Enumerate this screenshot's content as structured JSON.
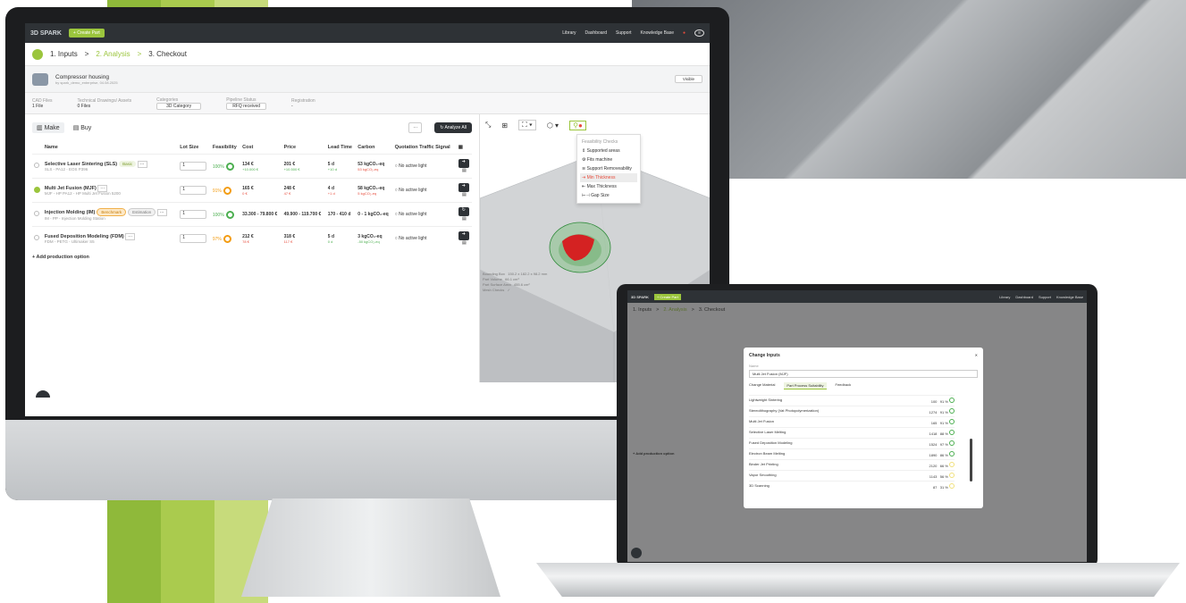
{
  "brand": {
    "stripe_colors": [
      "#9bc53d",
      "#b6d155",
      "#cbdb7e"
    ],
    "accent": "#9bc53d",
    "dark": "#2e3236"
  },
  "app": {
    "logo_text": "3D SPARK",
    "create_button": "+ Create Part",
    "nav": [
      "Library",
      "Dashboard",
      "Support",
      "Knowledge Base"
    ]
  },
  "breadcrumb": {
    "steps": [
      "1. Inputs",
      ">",
      "2. Analysis",
      ">",
      "3. Checkout"
    ]
  },
  "project": {
    "title": "Compressor housing",
    "subtitle": "by spark_demo_enterprise, 04.08.2025",
    "right_value": "Visible"
  },
  "meta": {
    "cad_label": "CAD Files",
    "cad_value": "1 File",
    "tech_label": "Technical Drawings/ Assets",
    "tech_value": "0 Files",
    "cat_label": "Categories",
    "cat_value": "3D Category",
    "pipeline_label": "Pipeline Status",
    "pipeline_value": "RFQ received",
    "reg_label": "Registration",
    "reg_value": "-"
  },
  "tabs": {
    "make": "Make",
    "buy": "Buy",
    "analyze_all": "Analyze All",
    "more": "···"
  },
  "table": {
    "headers": [
      "Name",
      "Lot Size",
      "Feasibility",
      "Cost",
      "Price",
      "Lead Time",
      "Carbon",
      "Quotation Traffic Signal"
    ],
    "rows": [
      {
        "name": "Selective Laser Sintering (SLS)",
        "sub": "SLS - PA12 - EOS P396",
        "badge": "Basic",
        "lot": "1",
        "feas": "100%",
        "cost": "134 €",
        "cost_sub": "+10.000 €",
        "price": "201 €",
        "price_sub": "+10.500 €",
        "lead": "5 d",
        "lead_sub": "+10 d",
        "carbon": "53 kgCO₂-eq",
        "carbon_sub": "53 kgCO₂-eq",
        "signal": "No active light"
      },
      {
        "name": "Multi Jet Fusion (MJF)",
        "sub": "MJF - HP PA12 - HP Multi Jet Fusion 5200",
        "badge": "",
        "lot": "1",
        "feas": "91%",
        "cost": "165 €",
        "cost_sub": "0 €",
        "price": "248 €",
        "price_sub": "47 €",
        "lead": "4 d",
        "lead_sub": "+1 d",
        "carbon": "58 kgCO₂-eq",
        "carbon_sub": "5 kgCO₂-eq",
        "signal": "No active light"
      },
      {
        "name": "Injection Molding (IM)",
        "sub": "IM - PP - Injection Molding Station",
        "badge": "Benchmark",
        "badge2": "Estimation",
        "lot": "1",
        "feas": "100%",
        "cost": "33.300 - 79.800 €",
        "cost_sub": "",
        "price": "49.900 - 119.700 €",
        "price_sub": "",
        "lead": "170 - 410 d",
        "lead_sub": "",
        "carbon": "0 - 1 kgCO₂-eq",
        "carbon_sub": "",
        "signal": "No active light"
      },
      {
        "name": "Fused Deposition Modeling (FDM)",
        "sub": "FDM - PETG - Ultimaker S5",
        "badge": "",
        "lot": "1",
        "feas": "97%",
        "cost": "212 €",
        "cost_sub": "78 €",
        "price": "318 €",
        "price_sub": "117 €",
        "lead": "5 d",
        "lead_sub": "0 d",
        "carbon": "3 kgCO₂-eq",
        "carbon_sub": "-50 kgCO₂-eq",
        "signal": "No active light"
      }
    ],
    "add_option": "+ Add production option"
  },
  "viewer": {
    "dropdown_title": "Feasibility Checks",
    "checks": [
      "Supported areas",
      "Fits machine",
      "Support Removeability",
      "Min Thickness",
      "Max Thickness",
      "Gap Size"
    ],
    "selected_check": "Min Thickness",
    "info": [
      {
        "label": "Bounding Box",
        "value": "150.2 x 182.2 x 98.2 mm"
      },
      {
        "label": "Part Volume",
        "value": "66.1 cm³"
      },
      {
        "label": "Part Surface Area",
        "value": "455.6 cm²"
      },
      {
        "label": "Mesh Checks",
        "value": "✓"
      }
    ]
  },
  "modal": {
    "title": "Change Inputs",
    "field_label": "Name",
    "field_value": "Multi Jet Fusion (MJF)",
    "tabs": [
      "Change Material",
      "Part Process Suitability",
      "Feedback"
    ],
    "active_tab": "Part Process Suitability",
    "rows": [
      {
        "name": "Lightweight Sintering",
        "v1": "100",
        "v2": "91 %",
        "ring": "g"
      },
      {
        "name": "Stereolithography (Vat Photopolymerization)",
        "v1": "1274",
        "v2": "91 %",
        "ring": "g"
      },
      {
        "name": "Multi Jet Fusion",
        "v1": "165",
        "v2": "91 %",
        "ring": "g"
      },
      {
        "name": "Selective Laser Melting",
        "v1": "1418",
        "v2": "88 %",
        "ring": "g"
      },
      {
        "name": "Fused Deposition Modeling",
        "v1": "1524",
        "v2": "97 %",
        "ring": "g"
      },
      {
        "name": "Electron Beam Melting",
        "v1": "1890",
        "v2": "86 %",
        "ring": "g"
      },
      {
        "name": "Binder Jet Printing",
        "v1": "2120",
        "v2": "66 %",
        "ring": "y"
      },
      {
        "name": "Vapor Smoothing",
        "v1": "1143",
        "v2": "56 %",
        "ring": "y"
      },
      {
        "name": "3D Scanning",
        "v1": "87",
        "v2": "31 %",
        "ring": "y"
      }
    ]
  }
}
